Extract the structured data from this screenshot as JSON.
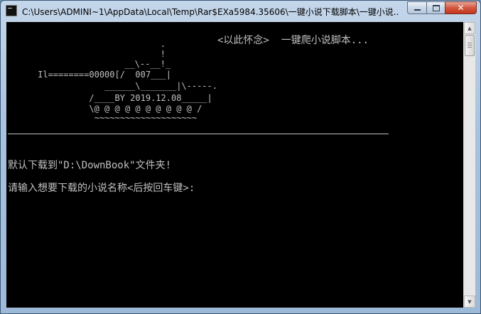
{
  "window": {
    "title": "C:\\Users\\ADMINI~1\\AppData\\Local\\Temp\\Rar$EXa5984.35606\\一键小说下载脚本\\一键小说..."
  },
  "console": {
    "banner_caption": "<以此怀念>  一键爬小说脚本...",
    "art": [
      "                              .",
      "                              !",
      "                       __\\--__!_",
      "     Il========00000[/  007___|",
      "                  ______\\_______|\\-----.",
      "               /____BY 2019.12.08_____|",
      "               \\@ @ @ @ @ @ @ @ @ @ /",
      "                ~~~~~~~~~~~~~~~~~~~~"
    ],
    "line_default_dir": "默认下载到\"D:\\DownBook\"文件夹!",
    "line_prompt": "请输入想要下载的小说名称<后按回车键>:"
  },
  "icons": {
    "app": "console-app-icon",
    "minimize": "minimize-icon",
    "maximize": "maximize-icon",
    "close": "close-icon",
    "scroll_up": "scroll-up-arrow-icon",
    "scroll_down": "scroll-down-arrow-icon"
  },
  "colors": {
    "console_background": "#000000",
    "console_text": "#c0c0c0",
    "close_button": "#c4361e"
  }
}
